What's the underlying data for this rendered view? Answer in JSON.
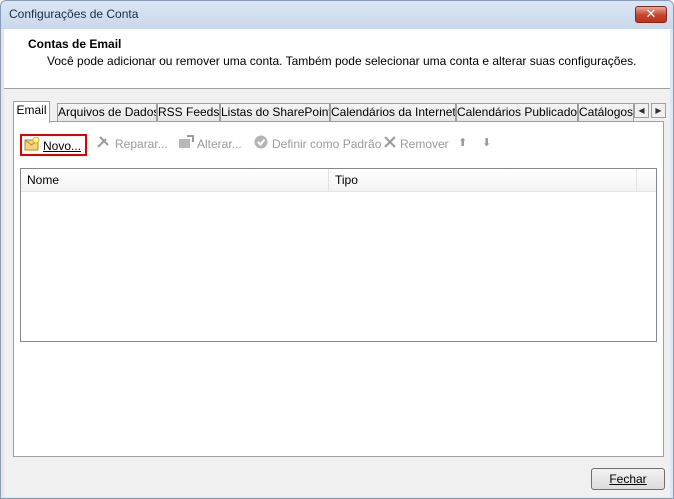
{
  "window": {
    "title": "Configurações de Conta",
    "close_glyph": "✕"
  },
  "header": {
    "title": "Contas de Email",
    "description": "Você pode adicionar ou remover uma conta. Também pode selecionar uma conta e alterar suas configurações."
  },
  "tabs": [
    {
      "label": "Email",
      "active": true
    },
    {
      "label": "Arquivos de Dados"
    },
    {
      "label": "RSS Feeds"
    },
    {
      "label": "Listas do SharePoint"
    },
    {
      "label": "Calendários da Internet"
    },
    {
      "label": "Calendários Publicados"
    },
    {
      "label": "Catálogos"
    }
  ],
  "tab_scroll": {
    "left": "◀",
    "right": "▶"
  },
  "toolbar": {
    "novo": "Novo...",
    "reparar": "Reparar...",
    "alterar": "Alterar...",
    "definir_padrao": "Definir como Padrão",
    "remover": "Remover",
    "move_up": "⬆",
    "move_down": "⬇"
  },
  "list": {
    "columns": [
      "Nome",
      "Tipo"
    ],
    "rows": []
  },
  "footer": {
    "close_label": "Fechar"
  },
  "colors": {
    "highlight_border": "#e00000",
    "disabled_text": "#9a9a9a"
  }
}
